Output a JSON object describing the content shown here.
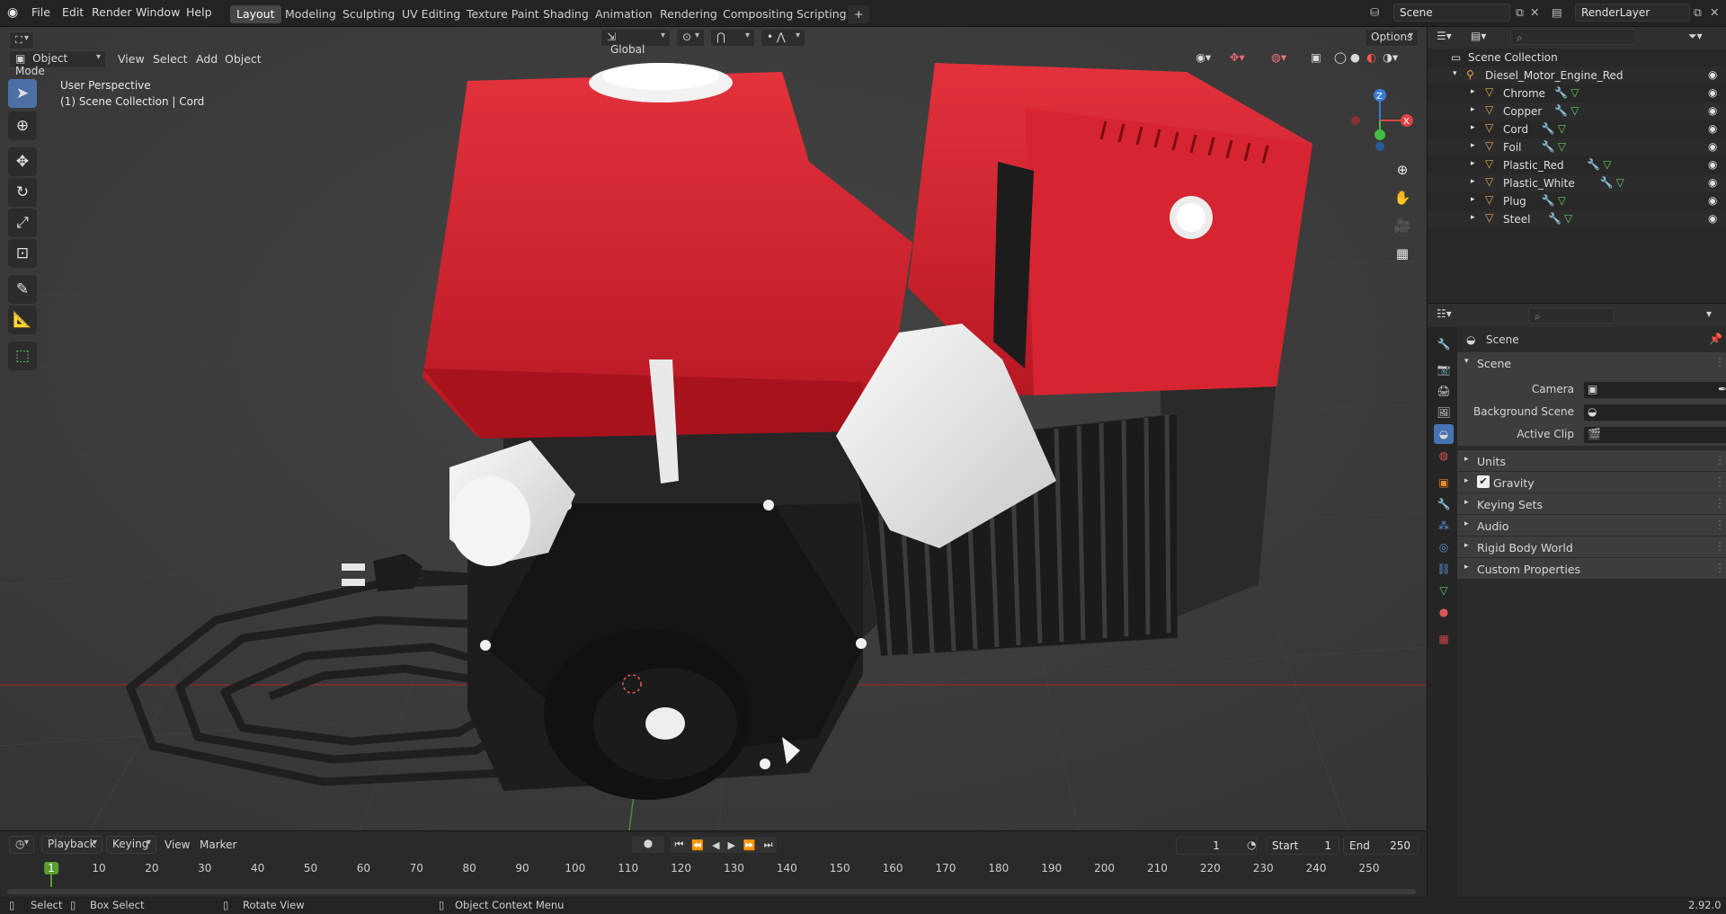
{
  "topbar": {
    "menus": [
      "File",
      "Edit",
      "Render",
      "Window",
      "Help"
    ],
    "workspaces": [
      "Layout",
      "Modeling",
      "Sculpting",
      "UV Editing",
      "Texture Paint",
      "Shading",
      "Animation",
      "Rendering",
      "Compositing",
      "Scripting"
    ],
    "active_workspace": "Layout",
    "add_tab": "+",
    "scene_name": "Scene",
    "view_layer": "RenderLayer"
  },
  "viewport": {
    "mode": "Object Mode",
    "menus": [
      "View",
      "Select",
      "Add",
      "Object"
    ],
    "orientation": "Global",
    "options": "Options",
    "overlay_line1": "User Perspective",
    "overlay_line2": "(1) Scene Collection | Cord",
    "gizmo": {
      "x": "X",
      "y": "Y",
      "z": "Z"
    }
  },
  "outliner": {
    "root": "Scene Collection",
    "collection": "Diesel_Motor_Engine_Red",
    "objects": [
      "Chrome",
      "Copper",
      "Cord",
      "Foil",
      "Plastic_Red",
      "Plastic_White",
      "Plug",
      "Steel"
    ],
    "active_object": "Cord"
  },
  "properties": {
    "title": "Scene",
    "panel": "Scene",
    "fields": [
      {
        "label": "Camera",
        "value": ""
      },
      {
        "label": "Background Scene",
        "value": ""
      },
      {
        "label": "Active Clip",
        "value": ""
      }
    ],
    "sections": [
      "Units",
      "Gravity",
      "Keying Sets",
      "Audio",
      "Rigid Body World",
      "Custom Properties"
    ],
    "gravity_checked": true
  },
  "timeline": {
    "menus": [
      "Playback",
      "Keying",
      "View",
      "Marker"
    ],
    "current_frame": "1",
    "start_label": "Start",
    "start": "1",
    "end_label": "End",
    "end": "250",
    "ticks": [
      "1",
      "10",
      "20",
      "30",
      "40",
      "50",
      "60",
      "70",
      "80",
      "90",
      "100",
      "110",
      "120",
      "130",
      "140",
      "150",
      "160",
      "170",
      "180",
      "190",
      "200",
      "210",
      "220",
      "230",
      "240",
      "250"
    ]
  },
  "statusbar": {
    "select": "Select",
    "box_select": "Box Select",
    "rotate_view": "Rotate View",
    "context_menu": "Object Context Menu",
    "version": "2.92.0"
  },
  "colors": {
    "accent_blue": "#4772b3",
    "active_tool": "#4c6fa6",
    "engine_red": "#d3222e",
    "frame_green": "#5a9e2f"
  }
}
